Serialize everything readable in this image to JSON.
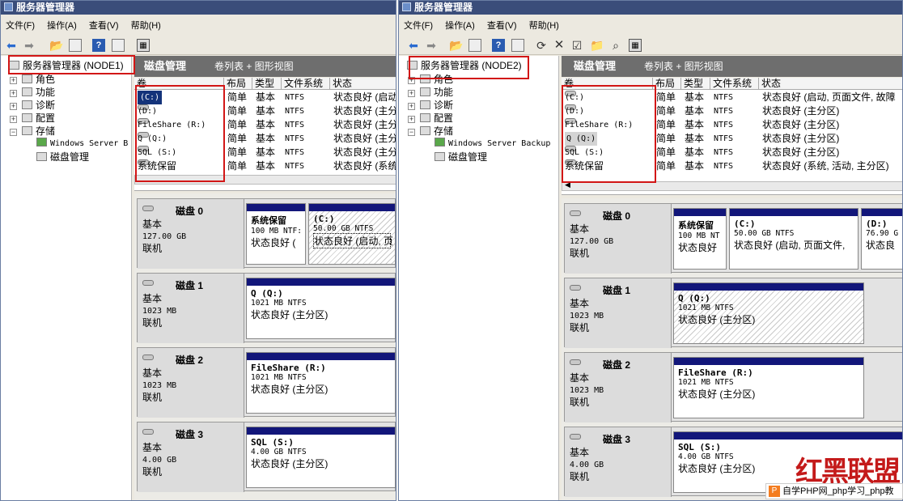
{
  "colors": {
    "title_bar": "#3a4d7a",
    "partition_bar": "#12167a",
    "highlight_box": "#d21616",
    "selection": "#14337a"
  },
  "left": {
    "window_title": "服务器管理器",
    "menu": [
      "文件(F)",
      "操作(A)",
      "查看(V)",
      "帮助(H)"
    ],
    "tree": {
      "root": "服务器管理器 (NODE1)",
      "items": [
        "角色",
        "功能",
        "诊断",
        "配置",
        "存储"
      ],
      "storage_children": [
        "Windows Server B",
        "磁盘管理"
      ]
    },
    "header": {
      "title": "磁盘管理",
      "subtitle": "卷列表 + 图形视图"
    },
    "columns": [
      "卷",
      "布局",
      "类型",
      "文件系统",
      "状态"
    ],
    "volumes": [
      {
        "name": "(C:)",
        "layout": "简单",
        "type": "基本",
        "fs": "NTFS",
        "status": "状态良好 (启动"
      },
      {
        "name": "(D:)",
        "layout": "简单",
        "type": "基本",
        "fs": "NTFS",
        "status": "状态良好 (主分"
      },
      {
        "name": "FileShare (R:)",
        "layout": "简单",
        "type": "基本",
        "fs": "NTFS",
        "status": "状态良好 (主分"
      },
      {
        "name": "Q (Q:)",
        "layout": "简单",
        "type": "基本",
        "fs": "NTFS",
        "status": "状态良好 (主分"
      },
      {
        "name": "SQL (S:)",
        "layout": "简单",
        "type": "基本",
        "fs": "NTFS",
        "status": "状态良好 (主分"
      },
      {
        "name": "系统保留",
        "layout": "简单",
        "type": "基本",
        "fs": "NTFS",
        "status": "状态良好 (系统"
      }
    ],
    "disks": [
      {
        "name": "磁盘 0",
        "type": "基本",
        "size": "127.00 GB",
        "state": "联机",
        "partitions": [
          {
            "name": "系统保留",
            "size": "100 MB NTF:",
            "status": "状态良好 ("
          },
          {
            "name": "(C:)",
            "size": "50.00 GB NTFS",
            "status": "状态良好 (启动, 页"
          }
        ]
      },
      {
        "name": "磁盘 1",
        "type": "基本",
        "size": "1023 MB",
        "state": "联机",
        "partitions": [
          {
            "name": "Q (Q:)",
            "size": "1021 MB NTFS",
            "status": "状态良好 (主分区)"
          }
        ]
      },
      {
        "name": "磁盘 2",
        "type": "基本",
        "size": "1023 MB",
        "state": "联机",
        "partitions": [
          {
            "name": "FileShare (R:)",
            "size": "1021 MB NTFS",
            "status": "状态良好 (主分区)"
          }
        ]
      },
      {
        "name": "磁盘 3",
        "type": "基本",
        "size": "4.00 GB",
        "state": "联机",
        "partitions": [
          {
            "name": "SQL (S:)",
            "size": "4.00 GB NTFS",
            "status": "状态良好 (主分区)"
          }
        ]
      }
    ]
  },
  "right": {
    "window_title": "服务器管理器",
    "menu": [
      "文件(F)",
      "操作(A)",
      "查看(V)",
      "帮助(H)"
    ],
    "tree": {
      "root": "服务器管理器 (NODE2)",
      "items": [
        "角色",
        "功能",
        "诊断",
        "配置",
        "存储"
      ],
      "storage_children": [
        "Windows Server Backup",
        "磁盘管理"
      ]
    },
    "header": {
      "title": "磁盘管理",
      "subtitle": "卷列表 + 图形视图"
    },
    "columns": [
      "卷",
      "布局",
      "类型",
      "文件系统",
      "状态"
    ],
    "volumes": [
      {
        "name": "(C:)",
        "layout": "简单",
        "type": "基本",
        "fs": "NTFS",
        "status": "状态良好 (启动, 页面文件, 故障"
      },
      {
        "name": "(D:)",
        "layout": "简单",
        "type": "基本",
        "fs": "NTFS",
        "status": "状态良好 (主分区)"
      },
      {
        "name": "FileShare (R:)",
        "layout": "简单",
        "type": "基本",
        "fs": "NTFS",
        "status": "状态良好 (主分区)"
      },
      {
        "name": "Q (Q:)",
        "layout": "简单",
        "type": "基本",
        "fs": "NTFS",
        "status": "状态良好 (主分区)"
      },
      {
        "name": "SQL (S:)",
        "layout": "简单",
        "type": "基本",
        "fs": "NTFS",
        "status": "状态良好 (主分区)"
      },
      {
        "name": "系统保留",
        "layout": "简单",
        "type": "基本",
        "fs": "NTFS",
        "status": "状态良好 (系统, 活动, 主分区)"
      }
    ],
    "disks": [
      {
        "name": "磁盘 0",
        "type": "基本",
        "size": "127.00 GB",
        "state": "联机",
        "partitions": [
          {
            "name": "系统保留",
            "size": "100 MB NT",
            "status": "状态良好"
          },
          {
            "name": "(C:)",
            "size": "50.00 GB NTFS",
            "status": "状态良好 (启动, 页面文件,"
          },
          {
            "name": "(D:)",
            "size": "76.90 G",
            "status": "状态良"
          }
        ]
      },
      {
        "name": "磁盘 1",
        "type": "基本",
        "size": "1023 MB",
        "state": "联机",
        "partitions": [
          {
            "name": "Q (Q:)",
            "size": "1021 MB NTFS",
            "status": "状态良好 (主分区)"
          }
        ]
      },
      {
        "name": "磁盘 2",
        "type": "基本",
        "size": "1023 MB",
        "state": "联机",
        "partitions": [
          {
            "name": "FileShare (R:)",
            "size": "1021 MB NTFS",
            "status": "状态良好 (主分区)"
          }
        ]
      },
      {
        "name": "磁盘 3",
        "type": "基本",
        "size": "4.00 GB",
        "state": "联机",
        "partitions": [
          {
            "name": "SQL (S:)",
            "size": "4.00 GB NTFS",
            "status": "状态良好 (主分区)"
          }
        ]
      }
    ]
  },
  "watermark": {
    "logo_text": "红黑联盟",
    "site_text": "自学PHP网_php学习_php教"
  }
}
